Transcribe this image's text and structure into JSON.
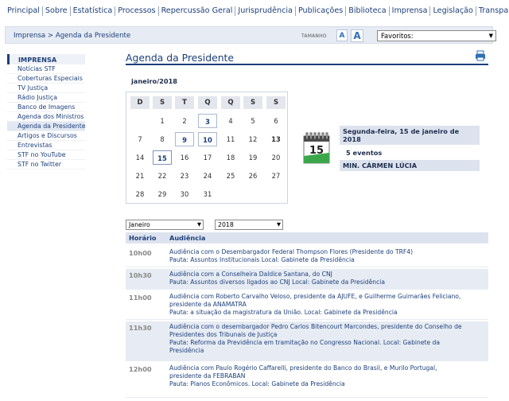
{
  "nav": [
    "Principal",
    "Sobre",
    "Estatística",
    "Processos",
    "Repercussão Geral",
    "Jurisprudência",
    "Publicações",
    "Biblioteca",
    "Imprensa",
    "Legislação",
    "Transparência"
  ],
  "breadcrumb": "Imprensa > Agenda da Presidente",
  "font_size": {
    "label": "TAMANHO",
    "small": "A",
    "large": "A"
  },
  "favorites_select": "Favoritos:",
  "sidebar": {
    "heading": "IMPRENSA",
    "items": [
      "Notícias STF",
      "Coberturas Especiais",
      "TV Justiça",
      "Rádio Justiça",
      "Banco de Imagens",
      "Agenda dos Ministros",
      "Agenda da Presidente",
      "Artigos e Discursos",
      "Entrevistas",
      "STF no YouTube",
      "STF no Twitter"
    ],
    "active_index": 6
  },
  "page_title": "Agenda da Presidente",
  "calendar": {
    "month_label": "janeiro/2018",
    "weekdays": [
      "D",
      "S",
      "T",
      "Q",
      "Q",
      "S",
      "S"
    ],
    "weeks": [
      [
        "",
        "1",
        "2",
        "3",
        "4",
        "5",
        "6"
      ],
      [
        "7",
        "8",
        "9",
        "10",
        "11",
        "12",
        "13"
      ],
      [
        "14",
        "15",
        "16",
        "17",
        "18",
        "19",
        "20"
      ],
      [
        "21",
        "22",
        "23",
        "24",
        "25",
        "26",
        "27"
      ],
      [
        "28",
        "29",
        "30",
        "31",
        "",
        "",
        ""
      ]
    ],
    "event_days": [
      "3",
      "9",
      "10"
    ],
    "bold_days": [
      "13"
    ],
    "selected_day": "15"
  },
  "date_panel": {
    "icon_day": "15",
    "date_text": "Segunda-feira, 15 de janeiro de 2018",
    "events_count": "5 eventos",
    "minister": "MIN. CÁRMEN LÚCIA"
  },
  "filters": {
    "month": "Janeiro",
    "year": "2018"
  },
  "schedule": {
    "col_time": "Horário",
    "col_event": "Audiência",
    "rows": [
      {
        "time": "10h00",
        "lines": [
          "Audiência com o Desembargador Federal Thompson Flores (Presidente do TRF4)",
          "Pauta: Assuntos Institucionais Local: Gabinete da Presidência"
        ]
      },
      {
        "time": "10h30",
        "lines": [
          "Audiência com a Conselheira Daldice Santana, do CNJ",
          "Pauta: Assuntos diversos ligados ao CNJ Local: Gabinete da Presidência"
        ]
      },
      {
        "time": "11h00",
        "lines": [
          "Audiência com Roberto Carvalho Veloso, presidente da AJUFE, e Guilherme Guimarães Feliciano,",
          "presidente da ANAMATRA",
          "Pauta: a situação da magistratura da União. Local: Gabinete da Presidência"
        ]
      },
      {
        "time": "11h30",
        "lines": [
          "Audiência com o desembargador Pedro Carlos Bitencourt Marcondes, presidente do Conselho de",
          "Presidentes dos Tribunais de Justiça",
          "Pauta: Reforma da Previdência em tramitação no Congresso Nacional. Local: Gabinete da",
          "Presidência"
        ]
      },
      {
        "time": "12h00",
        "lines": [
          "Audiência com Paulo Rogério Caffarelli, presidente do Banco do Brasil, e Murilo Portugal,",
          "presidente da FEBRABAN",
          "Pauta: Planos Econômicos. Local: Gabinete da Presidência"
        ]
      }
    ]
  },
  "colors": {
    "primary": "#1d3f7a",
    "shade": "#dde3ee",
    "accent": "#2f6fb6",
    "calendar_green": "#3aa84a"
  }
}
